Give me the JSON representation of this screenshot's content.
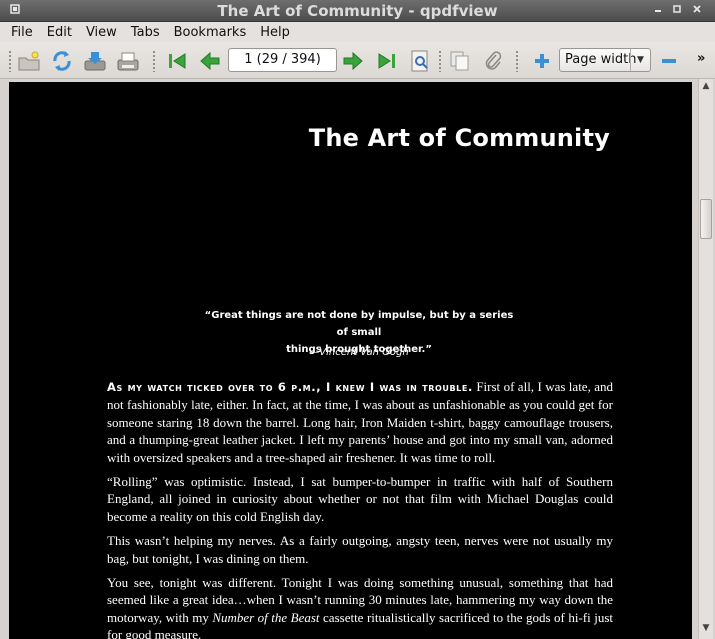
{
  "window": {
    "title": "The Art of Community - qpdfview",
    "menu_icon": "window-menu-icon",
    "controls": [
      "minimize-icon",
      "maximize-icon",
      "close-icon"
    ]
  },
  "menubar": {
    "items": [
      "File",
      "Edit",
      "View",
      "Tabs",
      "Bookmarks",
      "Help"
    ]
  },
  "toolbar": {
    "page_field": "1 (29 / 394)",
    "zoom": "Page width",
    "overflow": "»"
  },
  "document": {
    "title": "The Art of Community",
    "epigraph_line1": "“Great things are not done by impulse, but by a series of small",
    "epigraph_line2": "things brought together.”",
    "epigraph_author": "—Vincent Van Gogh",
    "lead_in": "As my watch ticked over to 6 p.m., I knew I was in trouble.",
    "p1_rest": " First of all, I was late, and not fashionably late, either. In fact, at the time, I was about as unfashionable as you could get for someone staring 18 down the barrel. Long hair, Iron Maiden t-shirt, baggy camouflage trousers, and a thumping-great leather jacket. I left my parents’ house and got into my small van, adorned with oversized speakers and a tree-shaped air freshener. It was time to roll.",
    "p2": "“Rolling” was optimistic. Instead, I sat bumper-to-bumper in traffic with half of Southern England, all joined in curiosity about whether or not that film with Michael Douglas could become a reality on this cold English day.",
    "p3": "This wasn’t helping my nerves. As a fairly outgoing, angsty teen, nerves were not usually my bag, but tonight, I was dining on them.",
    "p4_start": "You see, tonight was different. Tonight I was doing something unusual, something that had seemed like a great idea…when I wasn’t running 30 minutes late, hammering my way down the motorway, with my ",
    "p4_italic": "Number of the Beast",
    "p4_end": " cassette ritualistically sacrificed to the gods of hi-fi just for good measure."
  }
}
